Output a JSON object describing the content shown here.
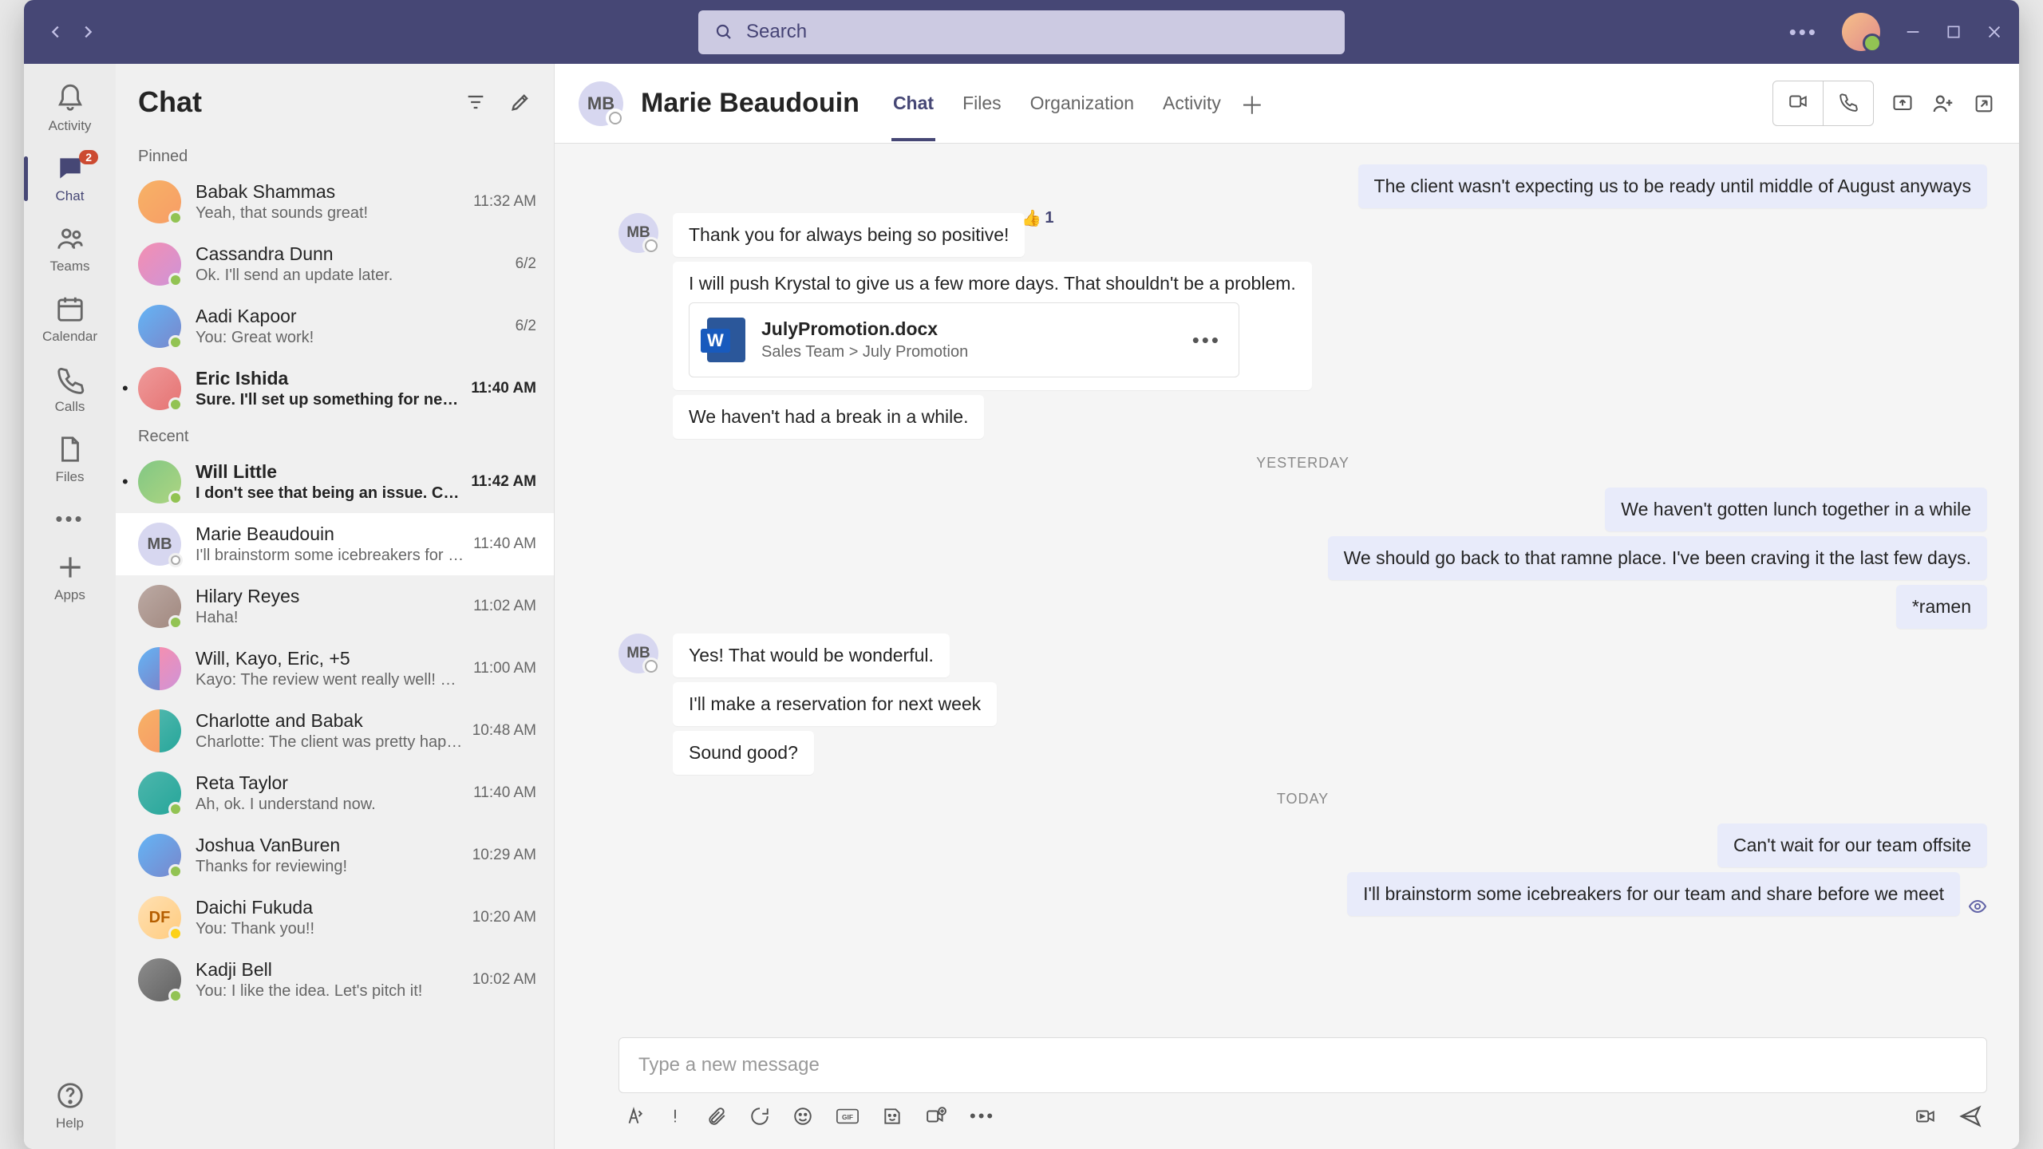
{
  "search": {
    "placeholder": "Search"
  },
  "rail": {
    "activity": "Activity",
    "chat": "Chat",
    "chat_badge": "2",
    "teams": "Teams",
    "calendar": "Calendar",
    "calls": "Calls",
    "files": "Files",
    "apps": "Apps",
    "help": "Help"
  },
  "chatlist": {
    "title": "Chat",
    "pinned_label": "Pinned",
    "recent_label": "Recent",
    "pinned": [
      {
        "name": "Babak Shammas",
        "preview": "Yeah, that sounds great!",
        "time": "11:32 AM"
      },
      {
        "name": "Cassandra Dunn",
        "preview": "Ok. I'll send an update later.",
        "time": "6/2"
      },
      {
        "name": "Aadi Kapoor",
        "preview": "You: Great work!",
        "time": "6/2"
      },
      {
        "name": "Eric Ishida",
        "preview": "Sure. I'll set up something for next week t…",
        "time": "11:40 AM"
      }
    ],
    "recent": [
      {
        "name": "Will Little",
        "preview": "I don't see that being an issue. Can you ta…",
        "time": "11:42 AM"
      },
      {
        "name": "Marie Beaudouin",
        "preview": "I'll brainstorm some icebreakers for our tea…",
        "time": "11:40 AM",
        "initials": "MB"
      },
      {
        "name": "Hilary Reyes",
        "preview": "Haha!",
        "time": "11:02 AM"
      },
      {
        "name": "Will, Kayo, Eric, +5",
        "preview": "Kayo: The review went really well! Can't wai…",
        "time": "11:00 AM"
      },
      {
        "name": "Charlotte and Babak",
        "preview": "Charlotte: The client was pretty happy with…",
        "time": "10:48 AM"
      },
      {
        "name": "Reta Taylor",
        "preview": "Ah, ok. I understand now.",
        "time": "11:40 AM"
      },
      {
        "name": "Joshua VanBuren",
        "preview": "Thanks for reviewing!",
        "time": "10:29 AM"
      },
      {
        "name": "Daichi Fukuda",
        "preview": "You: Thank you!!",
        "time": "10:20 AM",
        "initials": "DF"
      },
      {
        "name": "Kadji Bell",
        "preview": "You: I like the idea. Let's pitch it!",
        "time": "10:02 AM"
      }
    ]
  },
  "conversation": {
    "title": "Marie Beaudouin",
    "initials": "MB",
    "tabs": {
      "chat": "Chat",
      "files": "Files",
      "organization": "Organization",
      "activity": "Activity"
    },
    "messages": {
      "m0": "The client wasn't expecting us to be ready until middle of August anyways",
      "m1": "Thank you for always being so positive!",
      "m1_reaction_count": "1",
      "m2": "I will push Krystal to give us a few more days. That shouldn't be a problem.",
      "file_name": "JulyPromotion.docx",
      "file_path": "Sales Team > July Promotion",
      "m3": "We haven't had a break in a while.",
      "d1": "YESTERDAY",
      "m4": "We haven't gotten lunch together in a while",
      "m5": "We should go back to that ramne place. I've been craving it the last few days.",
      "m6": "*ramen",
      "m7": "Yes! That would be wonderful.",
      "m8": "I'll make a reservation for next week",
      "m9": "Sound good?",
      "d2": "TODAY",
      "m10": "Can't wait for our team offsite",
      "m11": "I'll brainstorm some icebreakers for our team and share before we meet"
    },
    "composer_placeholder": "Type a new message"
  }
}
